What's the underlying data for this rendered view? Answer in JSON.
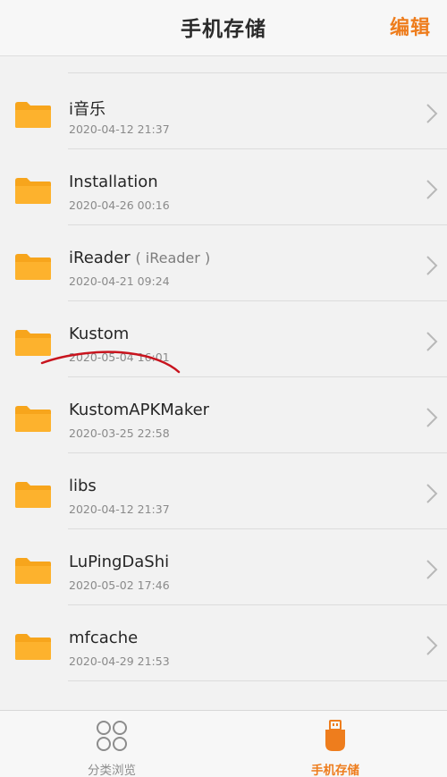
{
  "header": {
    "title": "手机存储",
    "edit_label": "编辑"
  },
  "colors": {
    "accent": "#ee7d1d",
    "folder": "#f9a31b",
    "annotation": "#c8141e"
  },
  "files": [
    {
      "name": "i音乐",
      "date": "2020-04-12 21:37",
      "icon": "folder-icon"
    },
    {
      "name": "Installation",
      "date": "2020-04-26 00:16",
      "icon": "folder-icon"
    },
    {
      "name": "iReader",
      "note": "( iReader )",
      "date": "2020-04-21 09:24",
      "icon": "folder-icon"
    },
    {
      "name": "Kustom",
      "date": "2020-05-04 16:01",
      "icon": "folder-icon"
    },
    {
      "name": "KustomAPKMaker",
      "date": "2020-03-25 22:58",
      "icon": "folder-icon"
    },
    {
      "name": "libs",
      "date": "2020-04-12 21:37",
      "icon": "folder-icon"
    },
    {
      "name": "LuPingDaShi",
      "date": "2020-05-02 17:46",
      "icon": "folder-icon"
    },
    {
      "name": "mfcache",
      "date": "2020-04-29 21:53",
      "icon": "folder-icon"
    }
  ],
  "bottom_nav": {
    "tabs": [
      {
        "label": "分类浏览",
        "icon": "category-grid-icon",
        "active": false
      },
      {
        "label": "手机存储",
        "icon": "usb-storage-icon",
        "active": true
      }
    ]
  }
}
